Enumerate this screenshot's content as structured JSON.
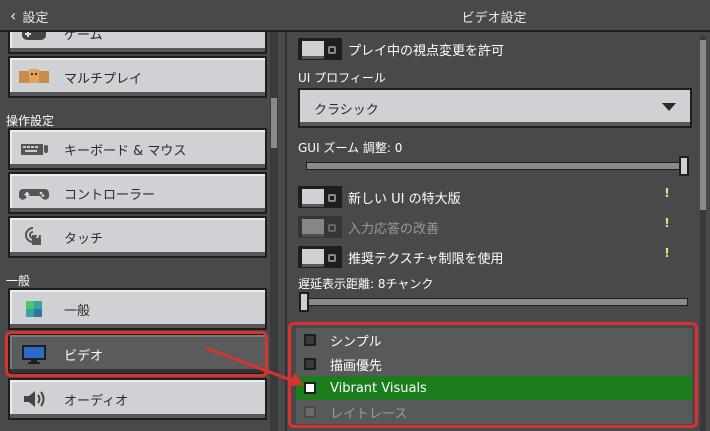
{
  "header": {
    "back_label": "設定",
    "title": "ビデオ設定"
  },
  "sidebar": {
    "items_top": [
      {
        "label": "ゲーム",
        "icon": "controller-icon"
      },
      {
        "label": "マルチプレイ",
        "icon": "multiplayer-icon"
      }
    ],
    "section_controls": "操作設定",
    "items_controls": [
      {
        "label": "キーボード & マウス",
        "icon": "keyboard-icon"
      },
      {
        "label": "コントローラー",
        "icon": "gamepad-icon"
      },
      {
        "label": "タッチ",
        "icon": "touch-icon"
      }
    ],
    "section_general": "一般",
    "items_general": [
      {
        "label": "一般",
        "icon": "globe-icon"
      },
      {
        "label": "ビデオ",
        "icon": "monitor-icon"
      },
      {
        "label": "オーディオ",
        "icon": "speaker-icon"
      }
    ]
  },
  "settings": {
    "perspective_toggle": "プレイ中の視点変更を許可",
    "ui_profile_label": "UI プロフィール",
    "ui_profile_value": "クラシック",
    "gui_zoom_label": "GUI ズーム 調整: 0",
    "new_ui_toggle": "新しい UI の特大版",
    "input_response_toggle": "入力応答の改善",
    "texture_limit_toggle": "推奨テクスチャ制限を使用",
    "render_distance_label": "遅延表示距離: 8チャンク",
    "graphics_modes": [
      {
        "label": "シンプル",
        "state": "normal"
      },
      {
        "label": "描画優先",
        "state": "normal"
      },
      {
        "label": "Vibrant Visuals",
        "state": "active"
      },
      {
        "label": "レイトレース",
        "state": "disabled"
      }
    ]
  },
  "colors": {
    "highlight": "#d9322f",
    "active": "#1c7d1c"
  }
}
